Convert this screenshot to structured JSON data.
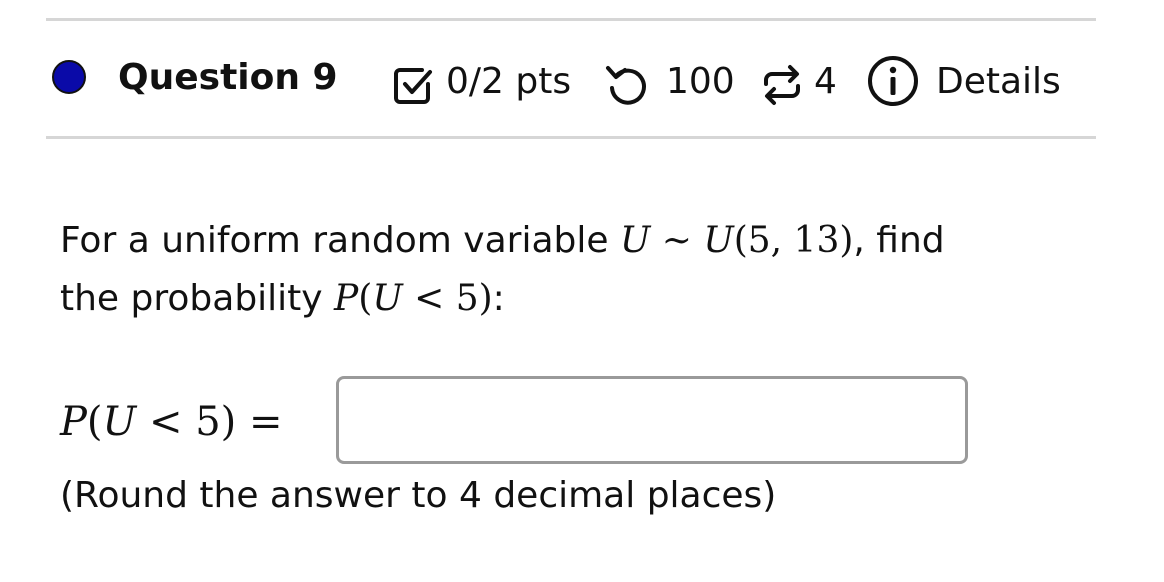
{
  "header": {
    "title": "Question 9",
    "points": "0/2 pts",
    "attempts": "100",
    "retries": "4",
    "details_label": "Details"
  },
  "icons": {
    "status": "status-dot",
    "points": "checkbox-icon",
    "attempts": "undo-icon",
    "retries": "repeat-icon",
    "details": "info-icon"
  },
  "colors": {
    "status_dot": "#0a0aa8",
    "divider": "#d6d6d6",
    "input_border": "#9a9a9a"
  },
  "question": {
    "text_before": "For a uniform random variable ",
    "dist_var": "U",
    "tilde": " ∼ ",
    "dist": "U",
    "dist_params": "(5, 13)",
    "text_mid": ", find",
    "text_line2": "the probability ",
    "prob_P": "P",
    "prob_open": "(",
    "prob_U": "U",
    "prob_rest": " < 5)",
    "text_end": ":"
  },
  "answer": {
    "label_P": "P",
    "label_open": "(",
    "label_U": "U",
    "label_rest": " < 5) =",
    "value": "",
    "placeholder": ""
  },
  "note": "(Round the answer to 4 decimal places)"
}
